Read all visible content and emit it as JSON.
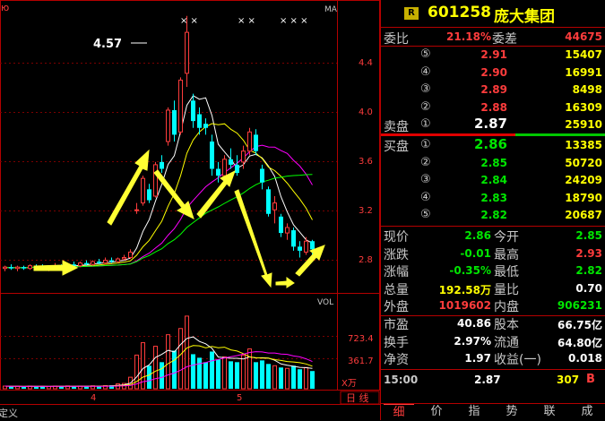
{
  "header": {
    "badge": "R",
    "code": "601258",
    "name": "庞大集团"
  },
  "weibi": {
    "label": "委比",
    "value": "21.18%",
    "diff_label": "委差",
    "diff": "44675"
  },
  "sell": [
    {
      "idx": "⑤",
      "price": "2.91",
      "vol": "15407"
    },
    {
      "idx": "④",
      "price": "2.90",
      "vol": "16991"
    },
    {
      "idx": "③",
      "price": "2.89",
      "vol": "8498"
    },
    {
      "idx": "②",
      "price": "2.88",
      "vol": "16309"
    },
    {
      "idx": "①",
      "price": "2.87",
      "vol": "25910"
    }
  ],
  "sell_label": "卖盘",
  "buy_label": "买盘",
  "buy": [
    {
      "idx": "①",
      "price": "2.86",
      "vol": "13385"
    },
    {
      "idx": "②",
      "price": "2.85",
      "vol": "50720"
    },
    {
      "idx": "③",
      "price": "2.84",
      "vol": "24209"
    },
    {
      "idx": "④",
      "price": "2.83",
      "vol": "18790"
    },
    {
      "idx": "⑤",
      "price": "2.82",
      "vol": "20687"
    }
  ],
  "stats": [
    {
      "l1": "现价",
      "v1": "2.86",
      "c1": "grn",
      "l2": "今开",
      "v2": "2.85",
      "c2": "grn"
    },
    {
      "l1": "涨跌",
      "v1": "-0.01",
      "c1": "grn",
      "l2": "最高",
      "v2": "2.93",
      "c2": "red"
    },
    {
      "l1": "涨幅",
      "v1": "-0.35%",
      "c1": "grn",
      "l2": "最低",
      "v2": "2.82",
      "c2": "grn"
    },
    {
      "l1": "总量",
      "v1": "192.58万",
      "c1": "yel",
      "l2": "量比",
      "v2": "0.70",
      "c2": "wht"
    },
    {
      "l1": "外盘",
      "v1": "1019602",
      "c1": "red",
      "l2": "内盘",
      "v2": "906231",
      "c2": "grn"
    }
  ],
  "fund": [
    {
      "l1": "市盈",
      "v1": "40.86",
      "l2": "股本",
      "v2": "66.75亿"
    },
    {
      "l1": "换手",
      "v1": "2.97%",
      "l2": "流通",
      "v2": "64.80亿"
    },
    {
      "l1": "净资",
      "v1": "1.97",
      "l2": "收益(一)",
      "v2": "0.018"
    }
  ],
  "tick": {
    "time": "15:00",
    "price": "2.87",
    "vol": "307",
    "side": "B"
  },
  "tabs": [
    "细",
    "价",
    "指",
    "势",
    "联",
    "成"
  ],
  "chart": {
    "ma_label": "MA",
    "vol_label": "VOL",
    "price_ticks": [
      "4.4",
      "4.0",
      "3.6",
      "3.2",
      "2.8"
    ],
    "vol_ticks": [
      "723.4",
      "361.7"
    ],
    "vol_unit": "X万",
    "date_ticks": [
      "4",
      "5"
    ],
    "peak_label": "4.57",
    "period_label": "日 线",
    "bottom_left": "定义",
    "top_left": "ю",
    "markers": [
      "× ×",
      "× ×",
      "× × ×",
      "×"
    ]
  },
  "colors": {
    "up": "#ff3c3c",
    "down": "#00ffff",
    "ma1": "#ffffff",
    "ma2": "#ffff00",
    "ma3": "#ff00ff",
    "ma4": "#00ff00",
    "arrow": "#ffff33"
  },
  "chart_data": {
    "type": "candlestick",
    "ylim": [
      2.6,
      4.7
    ],
    "candles": [
      [
        2.72,
        2.74,
        2.7,
        2.73
      ],
      [
        2.73,
        2.75,
        2.71,
        2.72
      ],
      [
        2.72,
        2.74,
        2.7,
        2.73
      ],
      [
        2.73,
        2.74,
        2.71,
        2.72
      ],
      [
        2.72,
        2.75,
        2.71,
        2.74
      ],
      [
        2.74,
        2.75,
        2.72,
        2.73
      ],
      [
        2.73,
        2.75,
        2.71,
        2.72
      ],
      [
        2.72,
        2.74,
        2.7,
        2.73
      ],
      [
        2.73,
        2.76,
        2.72,
        2.74
      ],
      [
        2.74,
        2.75,
        2.72,
        2.73
      ],
      [
        2.73,
        2.76,
        2.72,
        2.75
      ],
      [
        2.75,
        2.77,
        2.73,
        2.74
      ],
      [
        2.74,
        2.77,
        2.73,
        2.76
      ],
      [
        2.76,
        2.78,
        2.74,
        2.75
      ],
      [
        2.75,
        2.78,
        2.74,
        2.77
      ],
      [
        2.77,
        2.79,
        2.75,
        2.76
      ],
      [
        2.76,
        2.8,
        2.75,
        2.78
      ],
      [
        2.78,
        2.8,
        2.76,
        2.77
      ],
      [
        2.77,
        2.8,
        2.76,
        2.79
      ],
      [
        2.79,
        2.82,
        2.78,
        2.8
      ],
      [
        2.8,
        2.86,
        2.79,
        2.84
      ],
      [
        3.15,
        3.2,
        3.12,
        3.15
      ],
      [
        3.2,
        3.4,
        3.18,
        3.38
      ],
      [
        3.3,
        3.34,
        3.2,
        3.22
      ],
      [
        3.25,
        3.5,
        3.24,
        3.48
      ],
      [
        3.5,
        3.55,
        3.42,
        3.45
      ],
      [
        3.65,
        3.9,
        3.62,
        3.88
      ],
      [
        3.88,
        3.95,
        3.65,
        3.7
      ],
      [
        3.72,
        4.12,
        3.7,
        4.1
      ],
      [
        4.15,
        4.57,
        4.05,
        4.45
      ],
      [
        3.95,
        4.0,
        3.75,
        3.8
      ],
      [
        3.85,
        3.9,
        3.7,
        3.75
      ],
      [
        3.78,
        3.82,
        3.7,
        3.75
      ],
      [
        3.65,
        3.7,
        3.4,
        3.45
      ],
      [
        3.45,
        3.5,
        3.35,
        3.4
      ],
      [
        3.4,
        3.55,
        3.32,
        3.52
      ],
      [
        3.52,
        3.6,
        3.45,
        3.48
      ],
      [
        3.48,
        3.55,
        3.4,
        3.42
      ],
      [
        3.5,
        3.62,
        3.45,
        3.58
      ],
      [
        3.58,
        3.75,
        3.55,
        3.72
      ],
      [
        3.7,
        3.74,
        3.55,
        3.58
      ],
      [
        3.45,
        3.48,
        3.3,
        3.35
      ],
      [
        3.3,
        3.32,
        3.1,
        3.12
      ],
      [
        3.15,
        3.25,
        3.05,
        3.2
      ],
      [
        3.1,
        3.12,
        2.95,
        2.98
      ],
      [
        2.98,
        3.05,
        2.93,
        3.02
      ],
      [
        3.0,
        3.02,
        2.85,
        2.88
      ],
      [
        2.88,
        2.92,
        2.8,
        2.85
      ],
      [
        2.84,
        2.95,
        2.82,
        2.92
      ],
      [
        2.92,
        2.93,
        2.82,
        2.86
      ]
    ],
    "volumes": [
      30,
      25,
      28,
      22,
      30,
      26,
      28,
      25,
      30,
      27,
      32,
      28,
      30,
      29,
      33,
      31,
      35,
      40,
      55,
      60,
      130,
      380,
      520,
      260,
      480,
      300,
      610,
      430,
      680,
      820,
      390,
      350,
      300,
      420,
      330,
      360,
      310,
      300,
      380,
      450,
      300,
      320,
      280,
      260,
      240,
      230,
      260,
      220,
      240,
      200
    ]
  }
}
